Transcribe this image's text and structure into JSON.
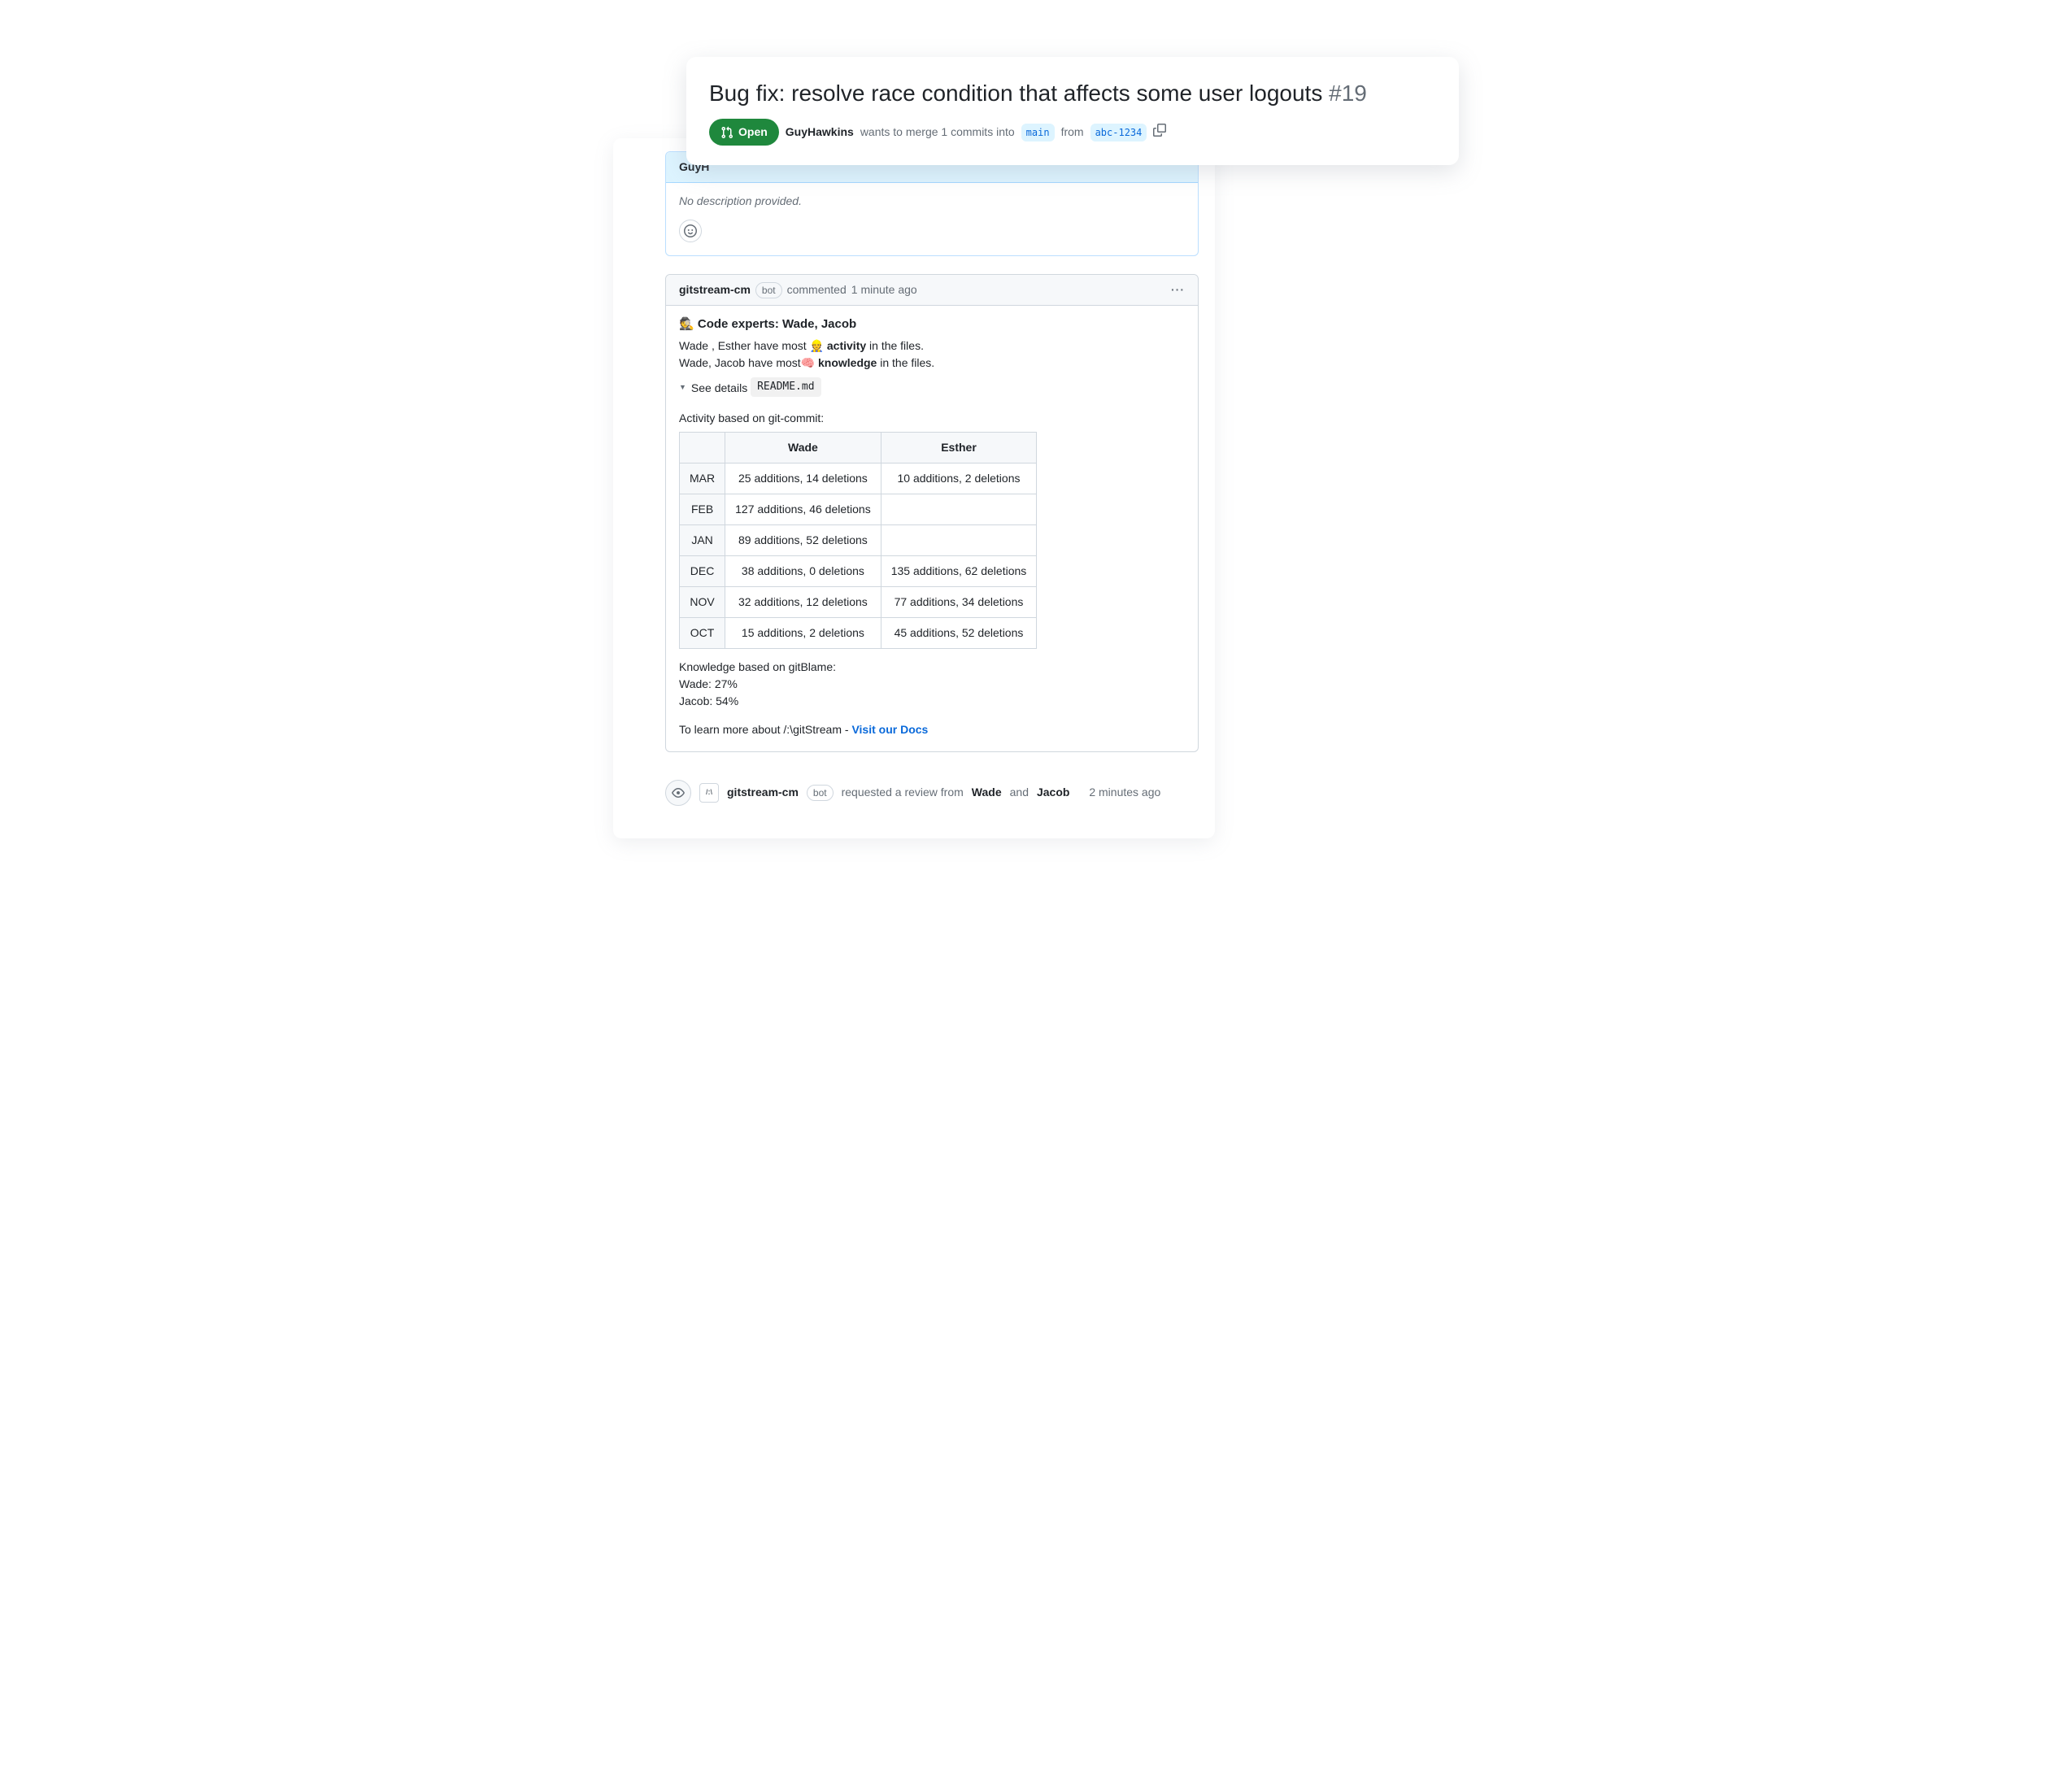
{
  "pr": {
    "title": "Bug fix: resolve race condition that affects some user logouts",
    "number": "#19",
    "state": "Open",
    "author": "GuyHawkins",
    "merge_text_pre": "wants to merge 1 commits into",
    "base_branch": "main",
    "merge_text_mid": "from",
    "head_branch": "abc-1234"
  },
  "first_comment": {
    "author_prefix": "GuyH",
    "body": "No description provided."
  },
  "bot_comment": {
    "author": "gitstream-cm",
    "bot_label": "bot",
    "time_prefix": "commented",
    "time": "1 minute ago",
    "experts_heading": "Code experts: Wade, Jacob",
    "activity_line_pre": "Wade , Esther have most ",
    "activity_word": "activity",
    "activity_line_post": " in the files.",
    "knowledge_line_pre": "Wade, Jacob have most",
    "knowledge_word": "knowledge",
    "knowledge_line_post": " in the files.",
    "details_label": "See details",
    "file": "README.md",
    "activity_section": "Activity based on git-commit:",
    "table": {
      "cols": [
        "",
        "Wade",
        "Esther"
      ],
      "rows": [
        {
          "month": "MAR",
          "wade": "25 additions, 14 deletions",
          "esther": "10 additions, 2 deletions"
        },
        {
          "month": "FEB",
          "wade": "127 additions, 46 deletions",
          "esther": ""
        },
        {
          "month": "JAN",
          "wade": "89 additions, 52 deletions",
          "esther": ""
        },
        {
          "month": "DEC",
          "wade": "38 additions, 0 deletions",
          "esther": "135 additions, 62 deletions"
        },
        {
          "month": "NOV",
          "wade": "32 additions, 12 deletions",
          "esther": "77 additions, 34 deletions"
        },
        {
          "month": "OCT",
          "wade": "15 additions, 2 deletions",
          "esther": "45 additions, 52 deletions"
        }
      ]
    },
    "knowledge_section": "Knowledge based on gitBlame:",
    "knowledge_rows": [
      "Wade: 27%",
      "Jacob: 54%"
    ],
    "docs_pre": "To learn more about /:\\gitStream - ",
    "docs_link": "Visit our Docs"
  },
  "review_event": {
    "author": "gitstream-cm",
    "bot_label": "bot",
    "text_pre": "requested a review from",
    "reviewer1": "Wade",
    "and": "and",
    "reviewer2": "Jacob",
    "time": "2 minutes ago"
  },
  "icons": {
    "bot_logo": "/:\\"
  }
}
